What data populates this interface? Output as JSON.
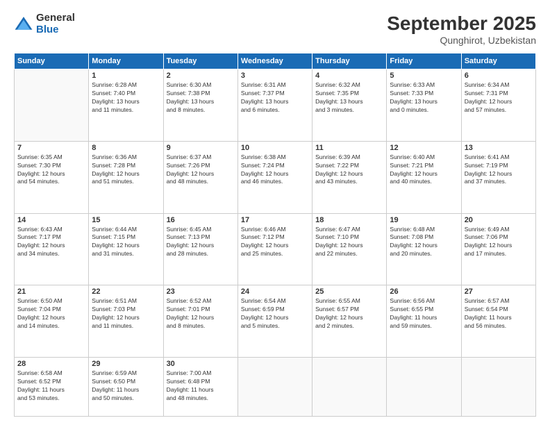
{
  "logo": {
    "general": "General",
    "blue": "Blue"
  },
  "header": {
    "monthYear": "September 2025",
    "location": "Qunghirot, Uzbekistan"
  },
  "dayHeaders": [
    "Sunday",
    "Monday",
    "Tuesday",
    "Wednesday",
    "Thursday",
    "Friday",
    "Saturday"
  ],
  "weeks": [
    [
      {
        "day": "",
        "content": ""
      },
      {
        "day": "1",
        "content": "Sunrise: 6:28 AM\nSunset: 7:40 PM\nDaylight: 13 hours\nand 11 minutes."
      },
      {
        "day": "2",
        "content": "Sunrise: 6:30 AM\nSunset: 7:38 PM\nDaylight: 13 hours\nand 8 minutes."
      },
      {
        "day": "3",
        "content": "Sunrise: 6:31 AM\nSunset: 7:37 PM\nDaylight: 13 hours\nand 6 minutes."
      },
      {
        "day": "4",
        "content": "Sunrise: 6:32 AM\nSunset: 7:35 PM\nDaylight: 13 hours\nand 3 minutes."
      },
      {
        "day": "5",
        "content": "Sunrise: 6:33 AM\nSunset: 7:33 PM\nDaylight: 13 hours\nand 0 minutes."
      },
      {
        "day": "6",
        "content": "Sunrise: 6:34 AM\nSunset: 7:31 PM\nDaylight: 12 hours\nand 57 minutes."
      }
    ],
    [
      {
        "day": "7",
        "content": "Sunrise: 6:35 AM\nSunset: 7:30 PM\nDaylight: 12 hours\nand 54 minutes."
      },
      {
        "day": "8",
        "content": "Sunrise: 6:36 AM\nSunset: 7:28 PM\nDaylight: 12 hours\nand 51 minutes."
      },
      {
        "day": "9",
        "content": "Sunrise: 6:37 AM\nSunset: 7:26 PM\nDaylight: 12 hours\nand 48 minutes."
      },
      {
        "day": "10",
        "content": "Sunrise: 6:38 AM\nSunset: 7:24 PM\nDaylight: 12 hours\nand 46 minutes."
      },
      {
        "day": "11",
        "content": "Sunrise: 6:39 AM\nSunset: 7:22 PM\nDaylight: 12 hours\nand 43 minutes."
      },
      {
        "day": "12",
        "content": "Sunrise: 6:40 AM\nSunset: 7:21 PM\nDaylight: 12 hours\nand 40 minutes."
      },
      {
        "day": "13",
        "content": "Sunrise: 6:41 AM\nSunset: 7:19 PM\nDaylight: 12 hours\nand 37 minutes."
      }
    ],
    [
      {
        "day": "14",
        "content": "Sunrise: 6:43 AM\nSunset: 7:17 PM\nDaylight: 12 hours\nand 34 minutes."
      },
      {
        "day": "15",
        "content": "Sunrise: 6:44 AM\nSunset: 7:15 PM\nDaylight: 12 hours\nand 31 minutes."
      },
      {
        "day": "16",
        "content": "Sunrise: 6:45 AM\nSunset: 7:13 PM\nDaylight: 12 hours\nand 28 minutes."
      },
      {
        "day": "17",
        "content": "Sunrise: 6:46 AM\nSunset: 7:12 PM\nDaylight: 12 hours\nand 25 minutes."
      },
      {
        "day": "18",
        "content": "Sunrise: 6:47 AM\nSunset: 7:10 PM\nDaylight: 12 hours\nand 22 minutes."
      },
      {
        "day": "19",
        "content": "Sunrise: 6:48 AM\nSunset: 7:08 PM\nDaylight: 12 hours\nand 20 minutes."
      },
      {
        "day": "20",
        "content": "Sunrise: 6:49 AM\nSunset: 7:06 PM\nDaylight: 12 hours\nand 17 minutes."
      }
    ],
    [
      {
        "day": "21",
        "content": "Sunrise: 6:50 AM\nSunset: 7:04 PM\nDaylight: 12 hours\nand 14 minutes."
      },
      {
        "day": "22",
        "content": "Sunrise: 6:51 AM\nSunset: 7:03 PM\nDaylight: 12 hours\nand 11 minutes."
      },
      {
        "day": "23",
        "content": "Sunrise: 6:52 AM\nSunset: 7:01 PM\nDaylight: 12 hours\nand 8 minutes."
      },
      {
        "day": "24",
        "content": "Sunrise: 6:54 AM\nSunset: 6:59 PM\nDaylight: 12 hours\nand 5 minutes."
      },
      {
        "day": "25",
        "content": "Sunrise: 6:55 AM\nSunset: 6:57 PM\nDaylight: 12 hours\nand 2 minutes."
      },
      {
        "day": "26",
        "content": "Sunrise: 6:56 AM\nSunset: 6:55 PM\nDaylight: 11 hours\nand 59 minutes."
      },
      {
        "day": "27",
        "content": "Sunrise: 6:57 AM\nSunset: 6:54 PM\nDaylight: 11 hours\nand 56 minutes."
      }
    ],
    [
      {
        "day": "28",
        "content": "Sunrise: 6:58 AM\nSunset: 6:52 PM\nDaylight: 11 hours\nand 53 minutes."
      },
      {
        "day": "29",
        "content": "Sunrise: 6:59 AM\nSunset: 6:50 PM\nDaylight: 11 hours\nand 50 minutes."
      },
      {
        "day": "30",
        "content": "Sunrise: 7:00 AM\nSunset: 6:48 PM\nDaylight: 11 hours\nand 48 minutes."
      },
      {
        "day": "",
        "content": ""
      },
      {
        "day": "",
        "content": ""
      },
      {
        "day": "",
        "content": ""
      },
      {
        "day": "",
        "content": ""
      }
    ]
  ]
}
